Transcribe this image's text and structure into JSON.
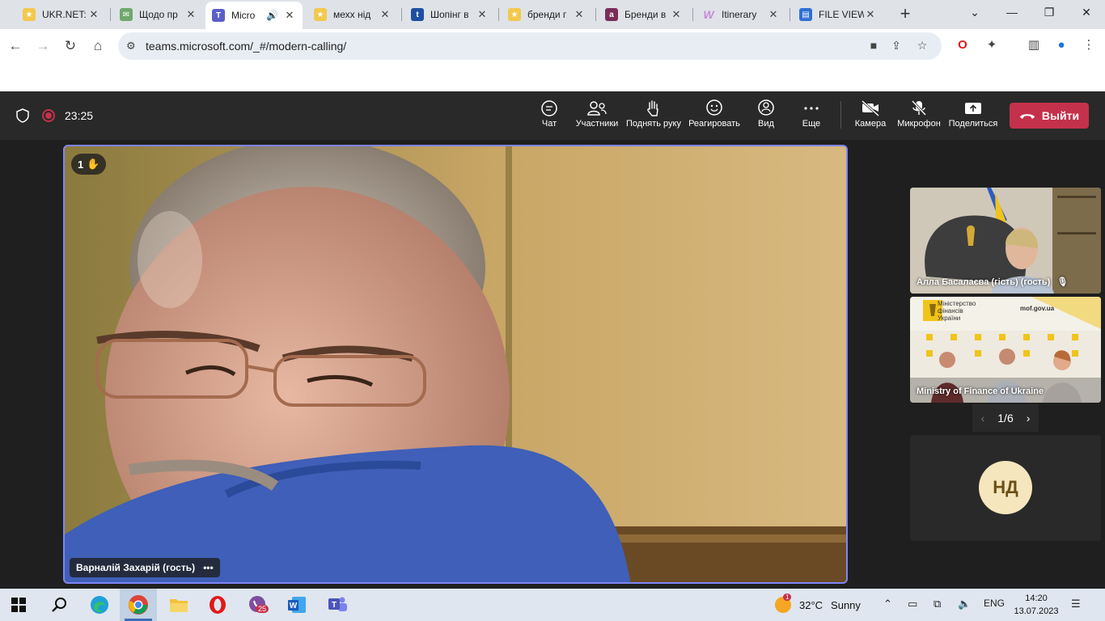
{
  "browser": {
    "tabs": [
      {
        "title": "UKR.NET:",
        "fav_color": "#f2c94c"
      },
      {
        "title": "Щодо пр",
        "fav_color": "#6fa86b"
      },
      {
        "title": "Micro",
        "fav_color": "#5b5fc7",
        "active": true
      },
      {
        "title": "мехх нід",
        "fav_color": "#f2c94c"
      },
      {
        "title": "Шопінг в",
        "fav_color": "#1e4fa1"
      },
      {
        "title": "бренди г",
        "fav_color": "#f2c94c"
      },
      {
        "title": "Бренди в",
        "fav_color": "#7b2d5a"
      },
      {
        "title": "Itinerary",
        "fav_color": "#c58ad8"
      },
      {
        "title": "FILE VIEW",
        "fav_color": "#2f6fd6"
      }
    ],
    "url": "teams.microsoft.com/_#/modern-calling/"
  },
  "meeting": {
    "timer": "23:25",
    "buttons": {
      "chat": "Чат",
      "participants": "Участники",
      "raise_hand": "Поднять руку",
      "react": "Реагировать",
      "view": "Вид",
      "more": "Еще",
      "camera": "Камера",
      "mic": "Микрофон",
      "share": "Поделиться",
      "leave": "Выйти"
    },
    "main_video": {
      "raised_hands": "1",
      "name": "Варналій Захарій (гость)"
    },
    "tiles": [
      {
        "name": "Алла Басалаєва (гість) (гость)"
      },
      {
        "name": "Ministry of Finance of Ukraine",
        "banner_text": "Міністерство фінансів України",
        "site": "mof.gov.ua"
      }
    ],
    "pager": "1/6",
    "avatar_tile": {
      "initials": "НД"
    }
  },
  "taskbar": {
    "weather_temp": "32°C",
    "weather_desc": "Sunny",
    "weather_badge": "1",
    "viber_badge": "25",
    "lang": "ENG",
    "time": "14:20",
    "date": "13.07.2023"
  },
  "colors": {
    "teams_accent": "#7f85f5",
    "leave_red": "#c4314b"
  }
}
